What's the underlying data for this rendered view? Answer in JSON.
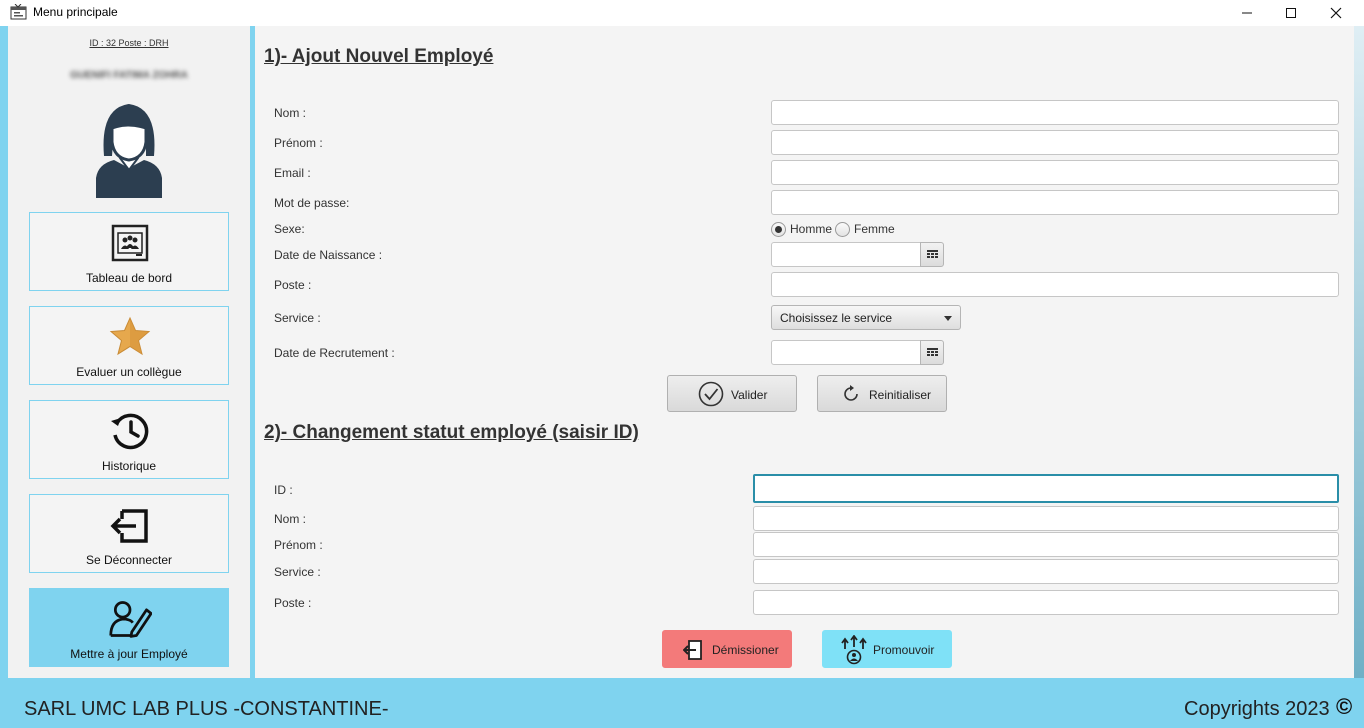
{
  "window": {
    "title": "Menu principale",
    "icons": {
      "app": "app-window-icon",
      "minimize": "minimize-icon",
      "maximize": "maximize-icon",
      "close": "close-icon"
    }
  },
  "sidebar": {
    "user_id_line": "ID : 32 Poste : DRH",
    "user_name": "GUENIFI FATIMA ZOHRA",
    "avatar_icon": "user-avatar-icon",
    "items": [
      {
        "label": "Tableau de bord",
        "icon": "dashboard-icon",
        "active": false
      },
      {
        "label": "Evaluer un collègue",
        "icon": "star-icon",
        "active": false
      },
      {
        "label": "Historique",
        "icon": "history-icon",
        "active": false
      },
      {
        "label": "Se Déconnecter",
        "icon": "logout-icon",
        "active": false
      },
      {
        "label": "Mettre à jour Employé",
        "icon": "edit-user-icon",
        "active": true
      }
    ]
  },
  "add_employee": {
    "title": "1)- Ajout Nouvel Employé",
    "labels": {
      "nom": "Nom :",
      "prenom": "Prénom :",
      "email": "Email :",
      "password": "Mot de passe:",
      "sexe": "Sexe:",
      "birth_date": "Date de Naissance :",
      "poste": "Poste :",
      "service": "Service :",
      "hire_date": "Date de Recrutement :"
    },
    "values": {
      "nom": "",
      "prenom": "",
      "email": "",
      "password": "",
      "birth_date": "",
      "poste": "",
      "hire_date": ""
    },
    "sexe_options": [
      "Homme",
      "Femme"
    ],
    "sexe_selected": "Homme",
    "service_select": "Choisissez le service",
    "validate_label": "Valider",
    "reset_label": "Reinitialiser"
  },
  "status_change": {
    "title": "2)- Changement statut employé (saisir ID)",
    "labels": {
      "id": "ID :",
      "nom": "Nom :",
      "prenom": "Prénom :",
      "service": "Service :",
      "poste": "Poste :"
    },
    "values": {
      "id": "",
      "nom": "",
      "prenom": "",
      "service": "",
      "poste": ""
    },
    "resign_label": "Démissioner",
    "promote_label": "Promouvoir"
  },
  "footer": {
    "company": "SARL UMC LAB PLUS -CONSTANTINE-",
    "copyright": "Copyrights 2023",
    "copyright_symbol": "©"
  },
  "colors": {
    "accent": "#7fd3ef",
    "resign": "#f37a7a",
    "promote": "#7fe1f7",
    "focus": "#2a8ea8"
  }
}
